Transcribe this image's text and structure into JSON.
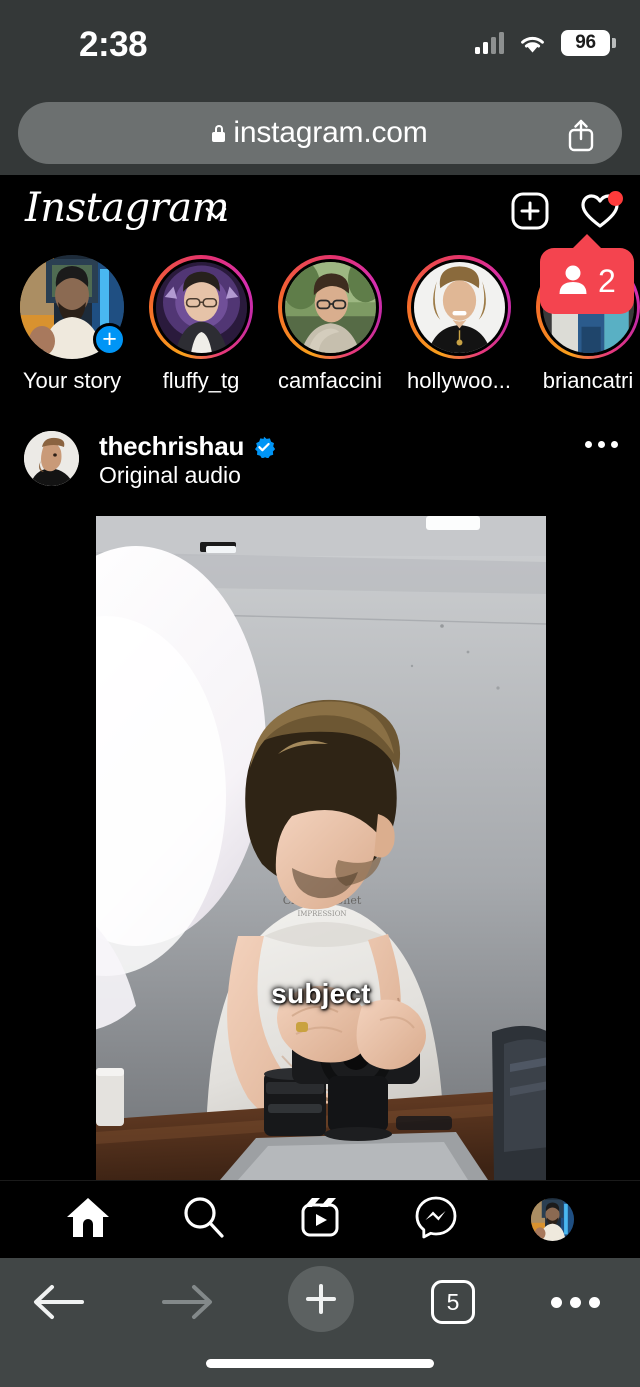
{
  "browser": {
    "status": {
      "time": "2:38",
      "battery_percent": "96",
      "signal_icon": "cellular-bars-icon",
      "wifi_icon": "wifi-icon",
      "battery_icon": "battery-icon"
    },
    "address_bar": {
      "url": "instagram.com",
      "lock_icon": "lock-icon",
      "share_icon": "share-icon"
    },
    "toolbar": {
      "back_icon": "arrow-left-icon",
      "forward_icon": "arrow-right-icon",
      "new_tab_icon": "plus-icon",
      "tab_count": "5",
      "more_icon": "ellipsis-icon"
    }
  },
  "app": {
    "header": {
      "logo_text": "Instagram",
      "dropdown_icon": "chevron-down-icon",
      "create_icon": "plus-square-icon",
      "activity_icon": "heart-icon",
      "has_activity_badge": true
    },
    "stories": [
      {
        "label": "Your story",
        "type": "own",
        "has_add_badge": true,
        "has_ring": false
      },
      {
        "label": "fluffy_tg",
        "type": "user",
        "has_add_badge": false,
        "has_ring": true
      },
      {
        "label": "camfaccini",
        "type": "user",
        "has_add_badge": false,
        "has_ring": true
      },
      {
        "label": "hollywoo...",
        "type": "user",
        "has_add_badge": false,
        "has_ring": true
      },
      {
        "label": "briancatri",
        "type": "user",
        "has_add_badge": false,
        "has_ring": true
      }
    ],
    "story_notification": {
      "count": "2",
      "person_icon": "person-icon"
    },
    "post": {
      "username": "thechrishau",
      "verified": true,
      "verified_icon": "verified-badge-icon",
      "audio_label": "Original audio",
      "more_icon": "ellipsis-icon",
      "avatar_name": "post-author-avatar",
      "media_caption": "subject"
    },
    "bottom_nav": [
      {
        "name": "home",
        "icon": "home-icon",
        "active": true
      },
      {
        "name": "search",
        "icon": "search-icon",
        "active": false
      },
      {
        "name": "reels",
        "icon": "reels-icon",
        "active": false
      },
      {
        "name": "messages",
        "icon": "messenger-icon",
        "active": false
      },
      {
        "name": "profile",
        "icon": "profile-avatar",
        "active": false
      }
    ]
  },
  "colors": {
    "safari_chrome": "#343838",
    "safari_bottom": "#414646",
    "urlbar_fill": "#6c7070",
    "app_bg": "#000000",
    "accent_blue": "#0095f6",
    "notify_red": "#f4444f",
    "heart_dot_red": "#fe3b3b",
    "story_ring_start": "#f9a01b",
    "story_ring_end": "#c32aa3"
  }
}
